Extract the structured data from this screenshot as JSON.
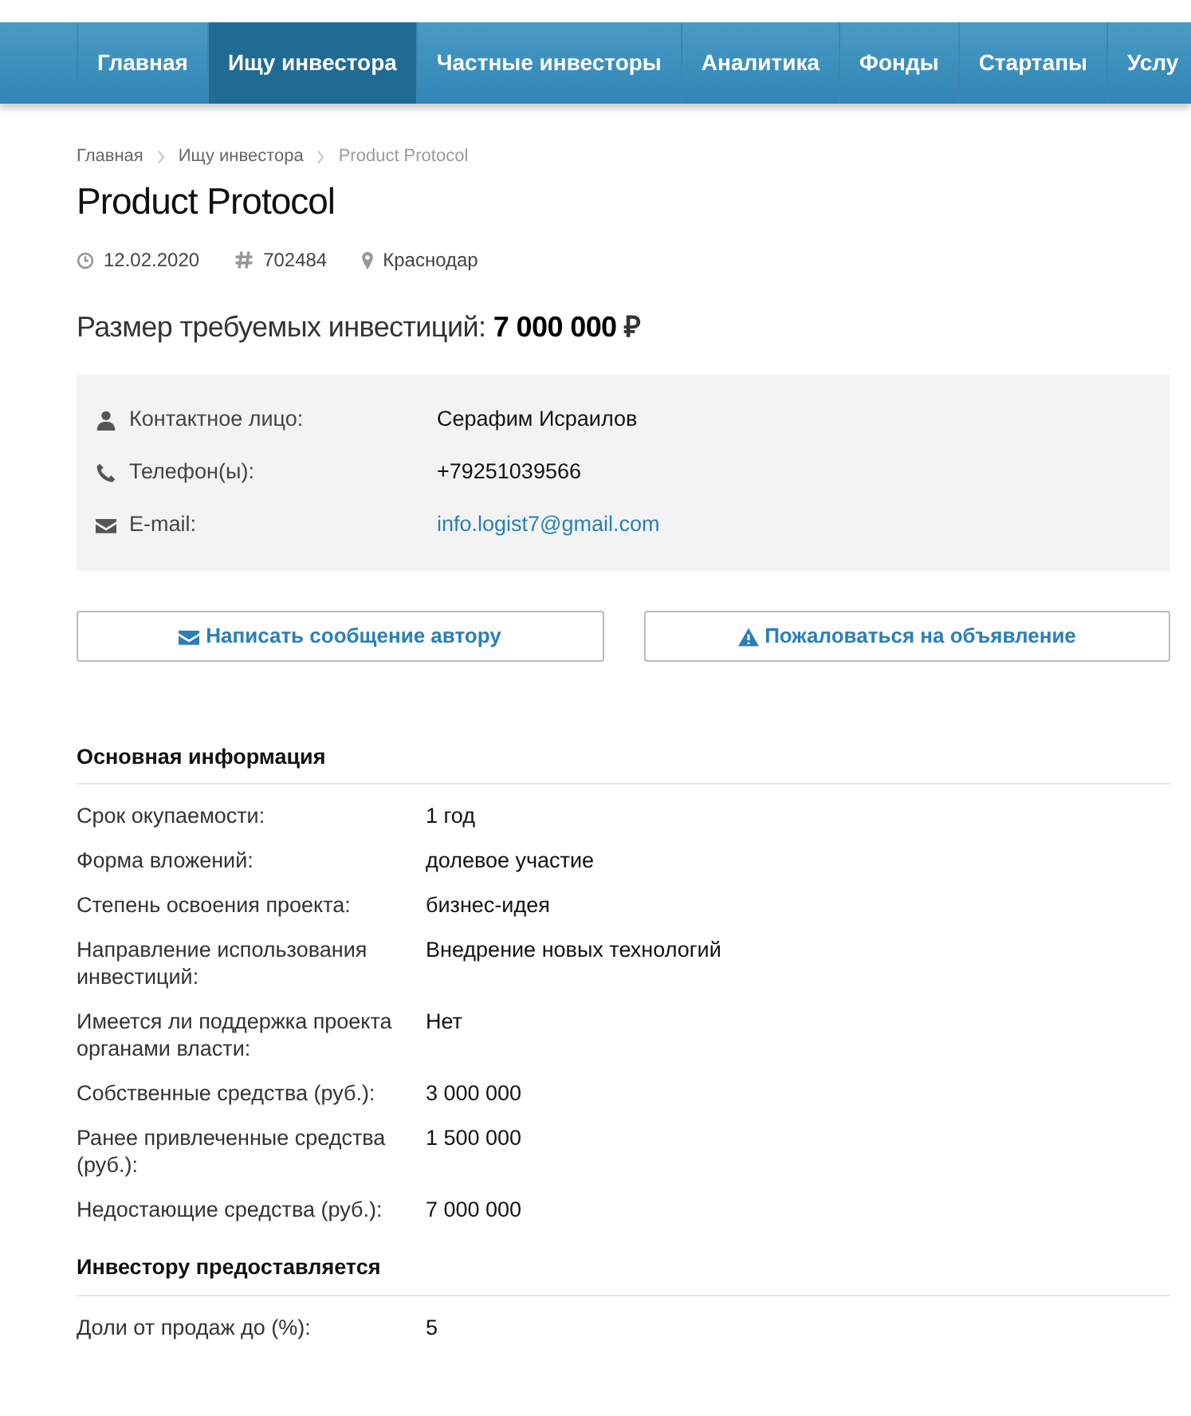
{
  "nav": [
    {
      "label": "Главная",
      "selected": false
    },
    {
      "label": "Ищу инвестора",
      "selected": true
    },
    {
      "label": "Частные инвесторы",
      "selected": false
    },
    {
      "label": "Аналитика",
      "selected": false
    },
    {
      "label": "Фонды",
      "selected": false
    },
    {
      "label": "Стартапы",
      "selected": false
    },
    {
      "label": "Услу",
      "selected": false
    }
  ],
  "breadcrumbs": [
    {
      "label": "Главная",
      "kind": "link"
    },
    {
      "label": "Ищу инвестора",
      "kind": "link"
    },
    {
      "label": "Product Protocol",
      "kind": "current"
    }
  ],
  "title": "Product Protocol",
  "meta": [
    {
      "kind": "date",
      "text": "12.02.2020"
    },
    {
      "kind": "id",
      "text": "702484"
    },
    {
      "kind": "location",
      "text": "Краснодар"
    }
  ],
  "investment": {
    "label": "Размер требуемых инвестиций:",
    "amount": "7 000 000",
    "currency": "₽"
  },
  "contacts": [
    {
      "kind": "person",
      "label": "Контактное лицо:",
      "value": "Серафим Исраилов"
    },
    {
      "kind": "phone",
      "label": "Телефон(ы):",
      "value": "+79251039566"
    },
    {
      "kind": "email",
      "label": "E-mail:",
      "value": "info.logist7@gmail.com"
    }
  ],
  "buttons": [
    {
      "kind": "message",
      "label": "Написать сообщение автору"
    },
    {
      "kind": "report",
      "label": "Пожаловаться на объявление"
    }
  ],
  "sections": [
    {
      "title": "Основная информация",
      "rows": [
        {
          "label": "Срок окупаемости:",
          "value": "1 год"
        },
        {
          "label": "Форма вложений:",
          "value": "долевое участие"
        },
        {
          "label": "Степень освоения проекта:",
          "value": "бизнес-идея"
        },
        {
          "label": "Направление использования инвестиций:",
          "value": "Внедрение новых технологий"
        },
        {
          "label": "Имеется ли поддержка проекта органами власти:",
          "value": "Нет"
        },
        {
          "label": "Собственные средства (руб.):",
          "value": "3 000 000"
        },
        {
          "label": "Ранее привлеченные средства (руб.):",
          "value": "1 500 000"
        },
        {
          "label": "Недостающие средства (руб.):",
          "value": "7 000 000"
        }
      ]
    },
    {
      "title": "Инвестору предоставляется",
      "rows": [
        {
          "label": "Доли от продаж до (%):",
          "value": "5"
        }
      ]
    }
  ]
}
